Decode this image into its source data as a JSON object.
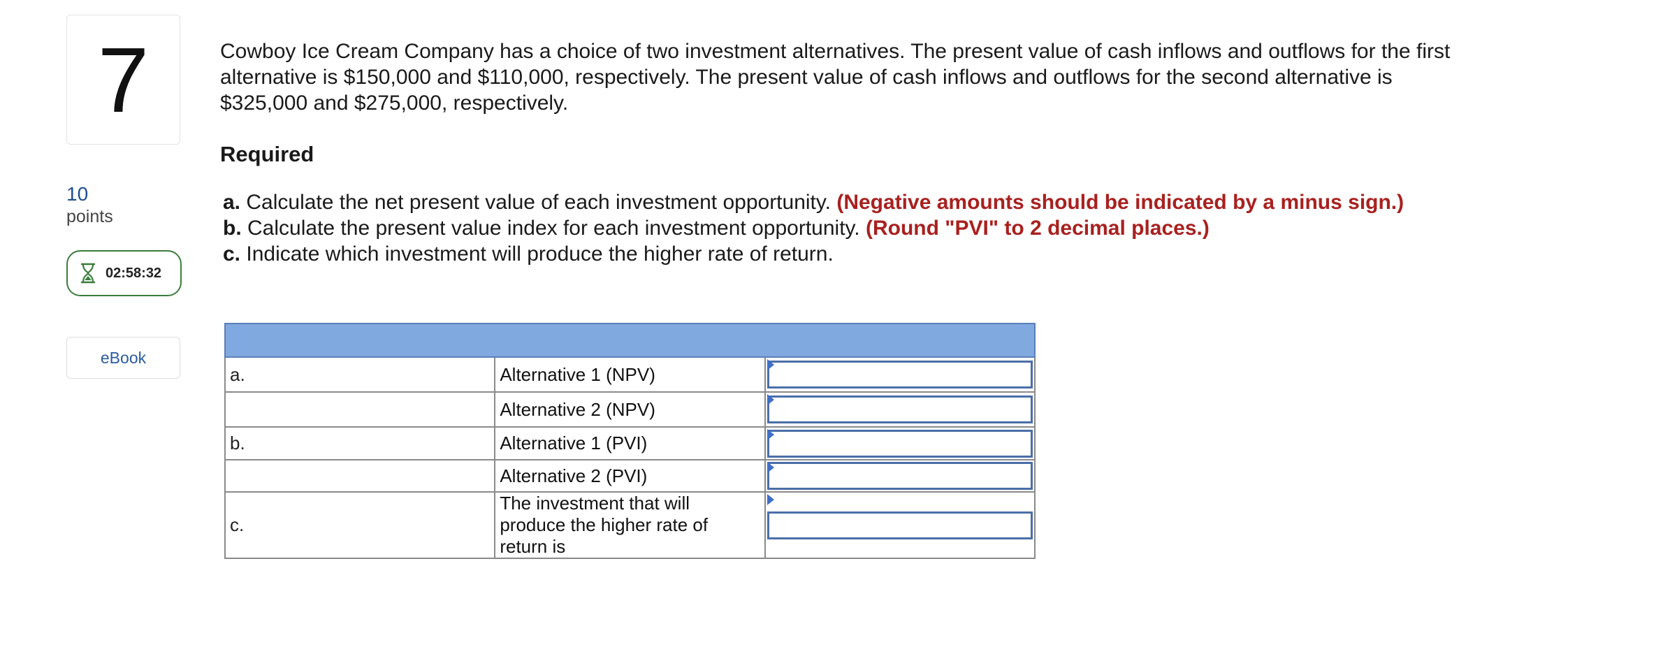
{
  "sidebar": {
    "question_number": "7",
    "points_value": "10",
    "points_label": "points",
    "timer": "02:58:32",
    "ebook_label": "eBook"
  },
  "question": {
    "lines": [
      "Cowboy Ice Cream Company has a choice of two investment alternatives. The present value of cash inflows and outflows for the first",
      "alternative is $150,000 and $110,000, respectively. The present value of cash inflows and outflows for the second alternative is",
      "$325,000 and $275,000, respectively."
    ],
    "required_heading": "Required",
    "requirements": [
      {
        "letter": "a.",
        "text": "Calculate the net present value of each investment opportunity.",
        "note": "(Negative amounts should be indicated by a minus sign.)"
      },
      {
        "letter": "b.",
        "text": "Calculate the present value index for each investment opportunity.",
        "note": "(Round \"PVI\" to 2 decimal places.)"
      },
      {
        "letter": "c.",
        "text": "Indicate which investment will produce the higher rate of return.",
        "note": ""
      }
    ]
  },
  "answer_table": {
    "rows": [
      {
        "label": "a.",
        "description": "Alternative 1 (NPV)",
        "value": ""
      },
      {
        "label": "",
        "description": "Alternative 2 (NPV)",
        "value": ""
      },
      {
        "label": "b.",
        "description": "Alternative 1 (PVI)",
        "value": ""
      },
      {
        "label": "",
        "description": "Alternative 2 (PVI)",
        "value": ""
      },
      {
        "label": "c.",
        "description": "The investment that will produce the higher rate of return is",
        "value": ""
      }
    ]
  },
  "colors": {
    "accent_red": "#a8211f",
    "table_header": "#80a9e0",
    "timer_border": "#3a7d3c",
    "link_blue": "#2a5ba0"
  }
}
